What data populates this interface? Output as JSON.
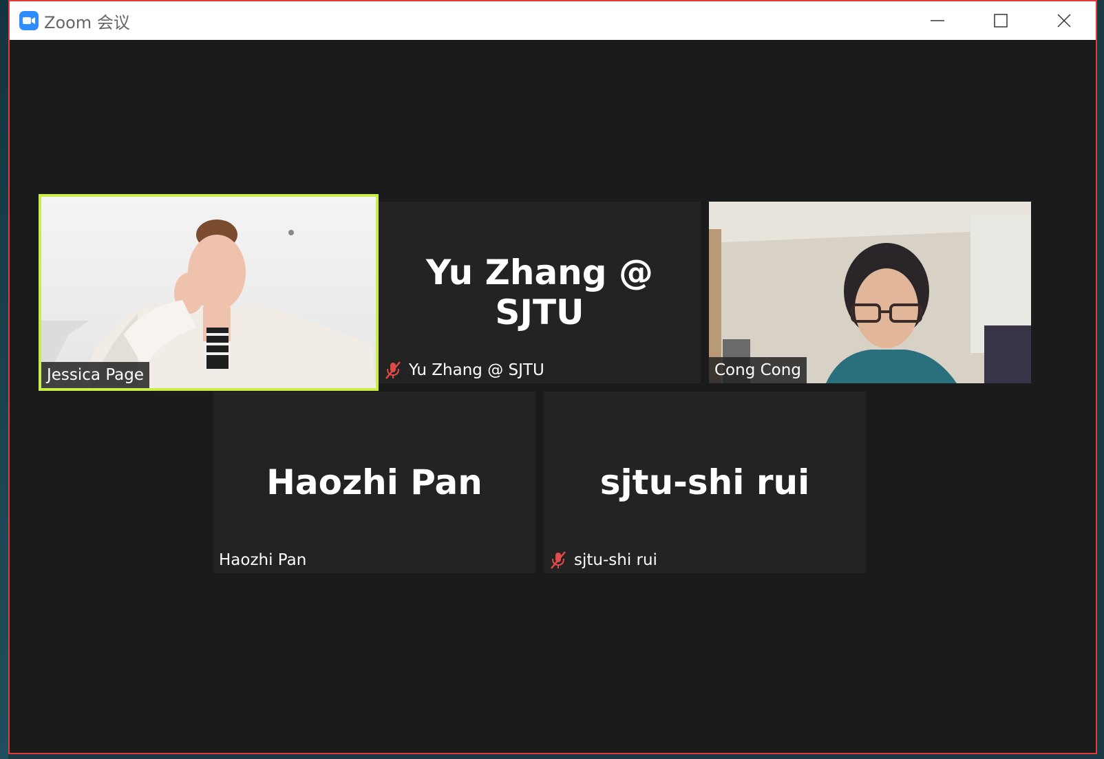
{
  "window": {
    "title": "Zoom 会议",
    "controls": {
      "minimize": "minimize",
      "maximize": "maximize",
      "close": "close"
    }
  },
  "participants": [
    {
      "name": "Jessica Page",
      "video": true,
      "muted": false,
      "active_speaker": true
    },
    {
      "name": "Yu Zhang @ SJTU",
      "video": false,
      "muted": true,
      "active_speaker": false
    },
    {
      "name": "Cong Cong",
      "video": true,
      "muted": false,
      "active_speaker": false
    },
    {
      "name": "Haozhi Pan",
      "video": false,
      "muted": false,
      "active_speaker": false
    },
    {
      "name": "sjtu-shi rui",
      "video": false,
      "muted": true,
      "active_speaker": false
    }
  ],
  "colors": {
    "accent": "#2d8cff",
    "active_border": "#c8ee4a",
    "muted": "#e24a4a",
    "stage_bg": "#1b1b1b",
    "tile_bg": "#232323"
  },
  "icons": {
    "app": "zoom-camera-icon",
    "muted": "mic-muted-icon"
  }
}
